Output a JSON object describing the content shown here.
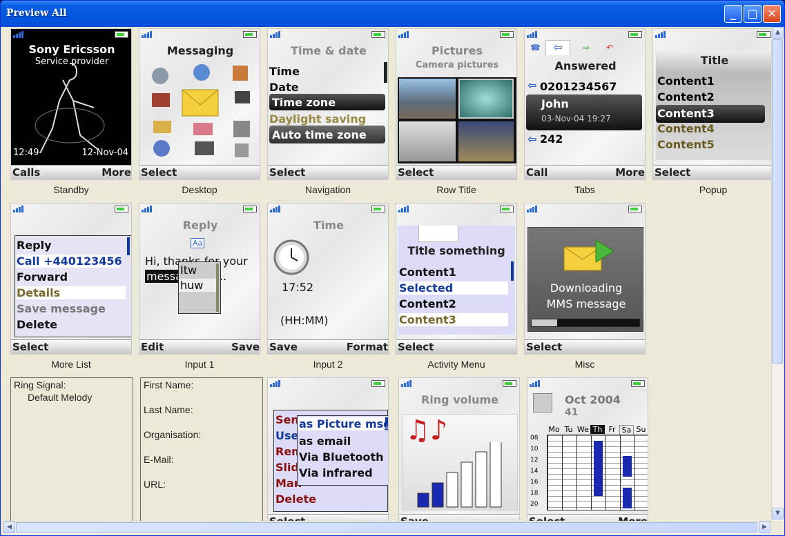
{
  "window": {
    "title": "Preview All"
  },
  "standby": {
    "operator": "Sony Ericsson",
    "provider": "Service provider",
    "time": "12:49",
    "date": "12-Nov-04",
    "left": "Calls",
    "right": "More",
    "caption": "Standby"
  },
  "desktop": {
    "title": "Messaging",
    "left": "Select",
    "caption": "Desktop"
  },
  "navigation": {
    "title": "Time & date",
    "items": [
      "Time",
      "Date",
      "Time zone",
      "Daylight saving",
      "Auto time zone"
    ],
    "left": "Select",
    "caption": "Navigation"
  },
  "row_title": {
    "title": "Pictures",
    "subtitle": "Camera pictures",
    "left": "Select",
    "caption": "Row Title"
  },
  "tabs": {
    "title": "Answered",
    "entries": [
      "0201234567",
      "John",
      "03-Nov-04 19:27",
      "242"
    ],
    "left": "Call",
    "right": "More",
    "caption": "Tabs"
  },
  "popup": {
    "title": "Title",
    "items": [
      "Content1",
      "Content2",
      "Content3",
      "Content4",
      "Content5"
    ],
    "left": "Select",
    "caption": "Popup"
  },
  "more_list": {
    "items": [
      "Reply",
      "Call +440123456",
      "Forward",
      "Details",
      "Save message",
      "Delete"
    ],
    "left": "Select",
    "caption": "More List"
  },
  "input1": {
    "title": "Reply",
    "mode": "Aa",
    "text1": "Hi, thanks for your",
    "text2": "messa",
    "text3": "..",
    "suggestions": [
      "Itw",
      "huw"
    ],
    "left": "Edit",
    "right": "Save",
    "caption": "Input 1"
  },
  "input2": {
    "title": "Time",
    "value": "17:52",
    "format": "(HH:MM)",
    "left": "Save",
    "right": "Format",
    "caption": "Input 2"
  },
  "activity": {
    "title": "Title something",
    "items": [
      "Content1",
      "Selected",
      "Content2",
      "Content3"
    ],
    "left": "Select",
    "caption": "Activity Menu"
  },
  "misc": {
    "line1": "Downloading",
    "line2": "MMS message",
    "progress": 0.24,
    "left": "Select",
    "caption": "Misc"
  },
  "ring_form": {
    "label": "Ring Signal:",
    "value": "Default Melody"
  },
  "contact_form": {
    "fields": [
      "First Name:",
      "Last Name:",
      "Organisation:",
      "E-Mail:",
      "URL:"
    ]
  },
  "send_menu": {
    "items": [
      "Send",
      "Use",
      "Rem",
      "Slide",
      "Man",
      "Delete"
    ],
    "submenu": [
      "as Picture msg",
      "as email",
      "Via Bluetooth",
      "Via infrared"
    ],
    "left": "Select"
  },
  "ring_volume": {
    "title": "Ring volume",
    "level": 0.33,
    "left": "Save"
  },
  "calendar": {
    "title": "Oct 2004",
    "week": "41",
    "days": [
      "Mo",
      "Tu",
      "We",
      "Th",
      "Fr",
      "Sa",
      "Su"
    ],
    "hours": [
      "08",
      "10",
      "12",
      "14",
      "16",
      "18",
      "20"
    ],
    "left": "Select",
    "right": "More"
  }
}
